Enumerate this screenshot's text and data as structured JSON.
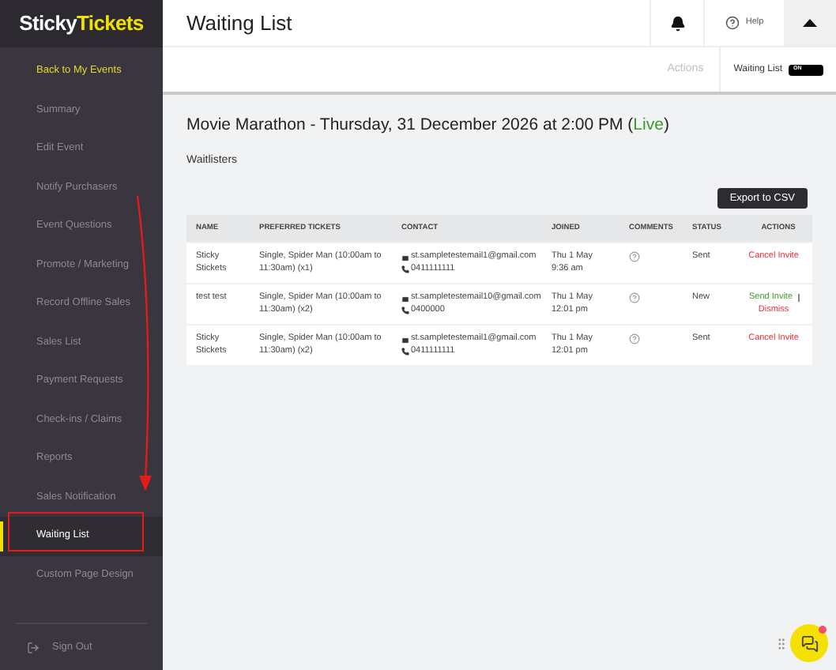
{
  "brand": {
    "first": "Sticky",
    "second": "Tickets"
  },
  "sidebar": {
    "items": [
      {
        "label": "Back to My Events",
        "kind": "back",
        "selected": false
      },
      {
        "label": "Summary",
        "kind": "item",
        "selected": false
      },
      {
        "label": "Edit Event",
        "kind": "item",
        "selected": false
      },
      {
        "label": "Notify Purchasers",
        "kind": "item",
        "selected": false
      },
      {
        "label": "Event Questions",
        "kind": "item",
        "selected": false
      },
      {
        "label": "Promote / Marketing",
        "kind": "item",
        "selected": false
      },
      {
        "label": "Record Offline Sales",
        "kind": "item",
        "selected": false
      },
      {
        "label": "Sales List",
        "kind": "item",
        "selected": false
      },
      {
        "label": "Payment Requests",
        "kind": "item",
        "selected": false
      },
      {
        "label": "Check-ins / Claims",
        "kind": "item",
        "selected": false
      },
      {
        "label": "Reports",
        "kind": "item",
        "selected": false
      },
      {
        "label": "Sales Notification",
        "kind": "item",
        "selected": false
      },
      {
        "label": "Waiting List",
        "kind": "item",
        "selected": true
      },
      {
        "label": "Custom Page Design",
        "kind": "item",
        "selected": false
      }
    ],
    "sign_out": "Sign Out"
  },
  "header": {
    "title": "Waiting List",
    "help": "Help"
  },
  "subbar": {
    "actions": "Actions",
    "toggle_label": "Waiting List",
    "toggle_text": "ON",
    "on": true
  },
  "event": {
    "title": "Movie Marathon - Thursday, 31 December 2026 at 2:00 PM (",
    "status": "Live",
    "suffix": ")"
  },
  "section_title": "Waitlisters",
  "export_button": "Export to CSV",
  "table": {
    "columns": [
      "NAME",
      "PREFERRED TICKETS",
      "CONTACT",
      "JOINED",
      "COMMENTS",
      "STATUS",
      "ACTIONS"
    ],
    "rows": [
      {
        "name": "Sticky Stickets",
        "tickets": "Single, Spider Man (10:00am to 11:30am) (x1)",
        "email": "st.sampletestemail1@gmail.com",
        "phone": "0411111111",
        "joined": "Thu 1 May 9:36 am",
        "status": "Sent",
        "actions": [
          {
            "label": "Cancel Invite",
            "kind": "negative"
          }
        ]
      },
      {
        "name": "test test",
        "tickets": "Single, Spider Man (10:00am to 11:30am) (x2)",
        "email": "st.sampletestemail10@gmail.com",
        "phone": "0400000",
        "joined": "Thu 1 May 12:01 pm",
        "status": "New",
        "actions": [
          {
            "label": "Send Invite",
            "kind": "positive"
          },
          {
            "label": "Dismiss",
            "kind": "negative"
          }
        ]
      },
      {
        "name": "Sticky Stickets",
        "tickets": "Single, Spider Man (10:00am to 11:30am) (x2)",
        "email": "st.sampletestemail1@gmail.com",
        "phone": "0411111111",
        "joined": "Thu 1 May 12:01 pm",
        "status": "Sent",
        "actions": [
          {
            "label": "Cancel Invite",
            "kind": "negative"
          }
        ]
      }
    ]
  }
}
